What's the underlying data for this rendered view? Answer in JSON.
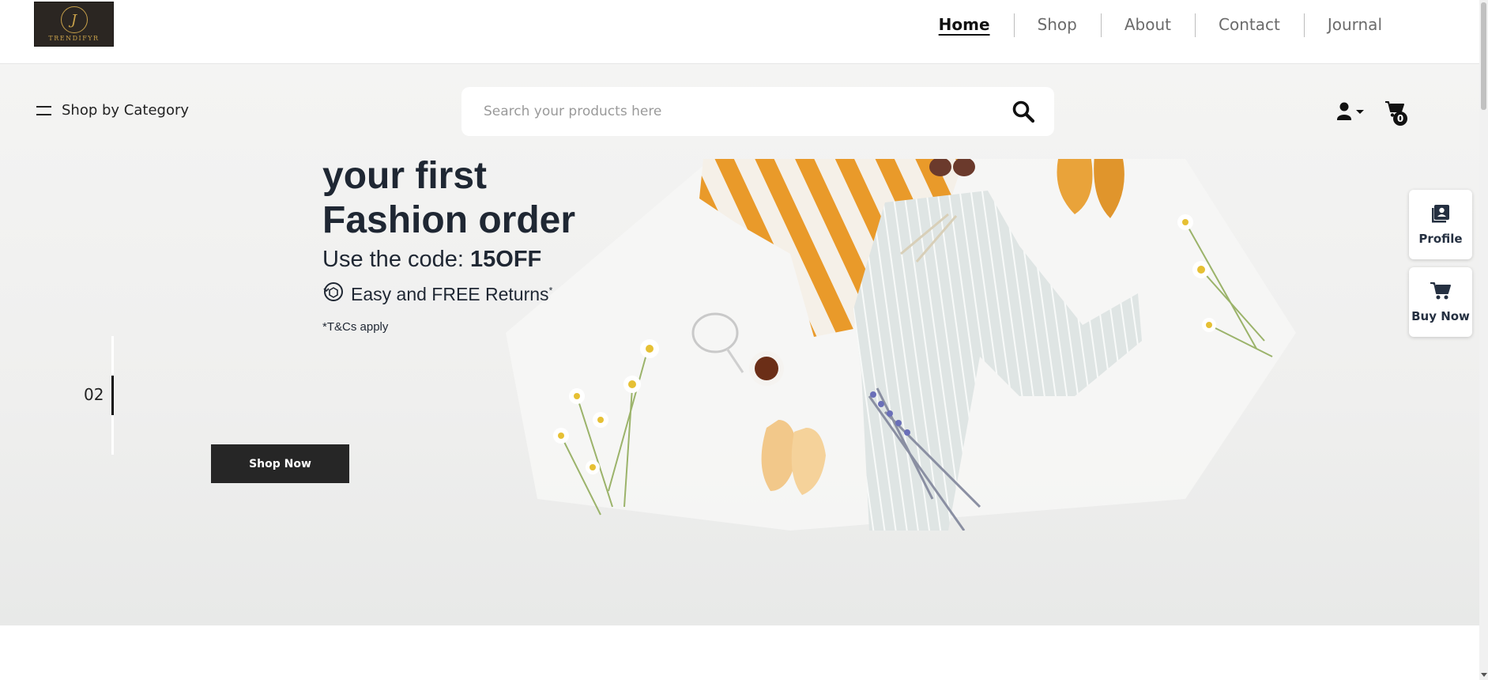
{
  "brand": {
    "logo_initial": "J",
    "logo_text": "TRENDIFYR"
  },
  "nav": {
    "items": [
      {
        "label": "Home",
        "active": true
      },
      {
        "label": "Shop",
        "active": false
      },
      {
        "label": "About",
        "active": false
      },
      {
        "label": "Contact",
        "active": false
      },
      {
        "label": "Journal",
        "active": false
      }
    ]
  },
  "category": {
    "label": "Shop by Category",
    "icon": "menu-icon"
  },
  "search": {
    "placeholder": "Search your products here",
    "value": "",
    "icon": "search-icon"
  },
  "header_icons": {
    "user_icon": "user-dropdown-icon",
    "cart_icon": "cart-icon",
    "cart_count": "0"
  },
  "hero": {
    "promo_line1": "your first",
    "promo_line2": "Fashion order",
    "code_prefix": "Use the code: ",
    "code_value": "15OFF",
    "returns_text": "Easy and FREE Returns",
    "returns_mark": "*",
    "tcs": "*T&Cs apply",
    "slide_number": "02",
    "cta_label": "Shop Now"
  },
  "side_widgets": [
    {
      "label": "Profile",
      "icon": "profile-icon"
    },
    {
      "label": "Buy Now",
      "icon": "cart-icon"
    }
  ],
  "colors": {
    "accent": "#262626",
    "hero_bg": "#f1f1f0",
    "text_dark": "#1f2733",
    "logo_bg": "#2b2622",
    "logo_gold": "#c8a14a",
    "shirt_orange": "#e99a2a",
    "pants_gray": "#d7dedd"
  }
}
